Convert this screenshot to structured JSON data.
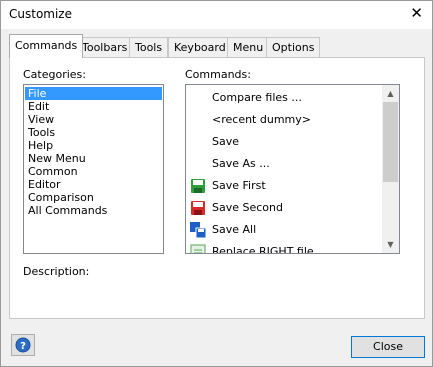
{
  "window": {
    "title": "Customize"
  },
  "tabs": [
    {
      "label": "Commands",
      "active": true
    },
    {
      "label": "Toolbars",
      "active": false
    },
    {
      "label": "Tools",
      "active": false
    },
    {
      "label": "Keyboard",
      "active": false
    },
    {
      "label": "Menu",
      "active": false
    },
    {
      "label": "Options",
      "active": false
    }
  ],
  "categories": {
    "label": "Categories:",
    "items": [
      "File",
      "Edit",
      "View",
      "Tools",
      "Help",
      "New Menu",
      "Common",
      "Editor",
      "Comparison",
      "All Commands"
    ],
    "selected": "File"
  },
  "commands": {
    "label": "Commands:",
    "items": [
      {
        "label": "Compare files ...",
        "icon": "none"
      },
      {
        "label": "<recent dummy>",
        "icon": "none"
      },
      {
        "label": "Save",
        "icon": "none"
      },
      {
        "label": "Save As ...",
        "icon": "none"
      },
      {
        "label": "Save First",
        "icon": "save-first-icon"
      },
      {
        "label": "Save Second",
        "icon": "save-second-icon"
      },
      {
        "label": "Save All",
        "icon": "save-all-icon"
      },
      {
        "label": "Replace RIGHT file",
        "icon": "replace-right-icon"
      }
    ]
  },
  "description": {
    "label": "Description:"
  },
  "buttons": {
    "close": "Close",
    "help": "?"
  },
  "colors": {
    "selection": "#3399ff",
    "save_first": "#2e9e3e",
    "save_second": "#d52b2b",
    "save_all": "#1f5fc4"
  }
}
